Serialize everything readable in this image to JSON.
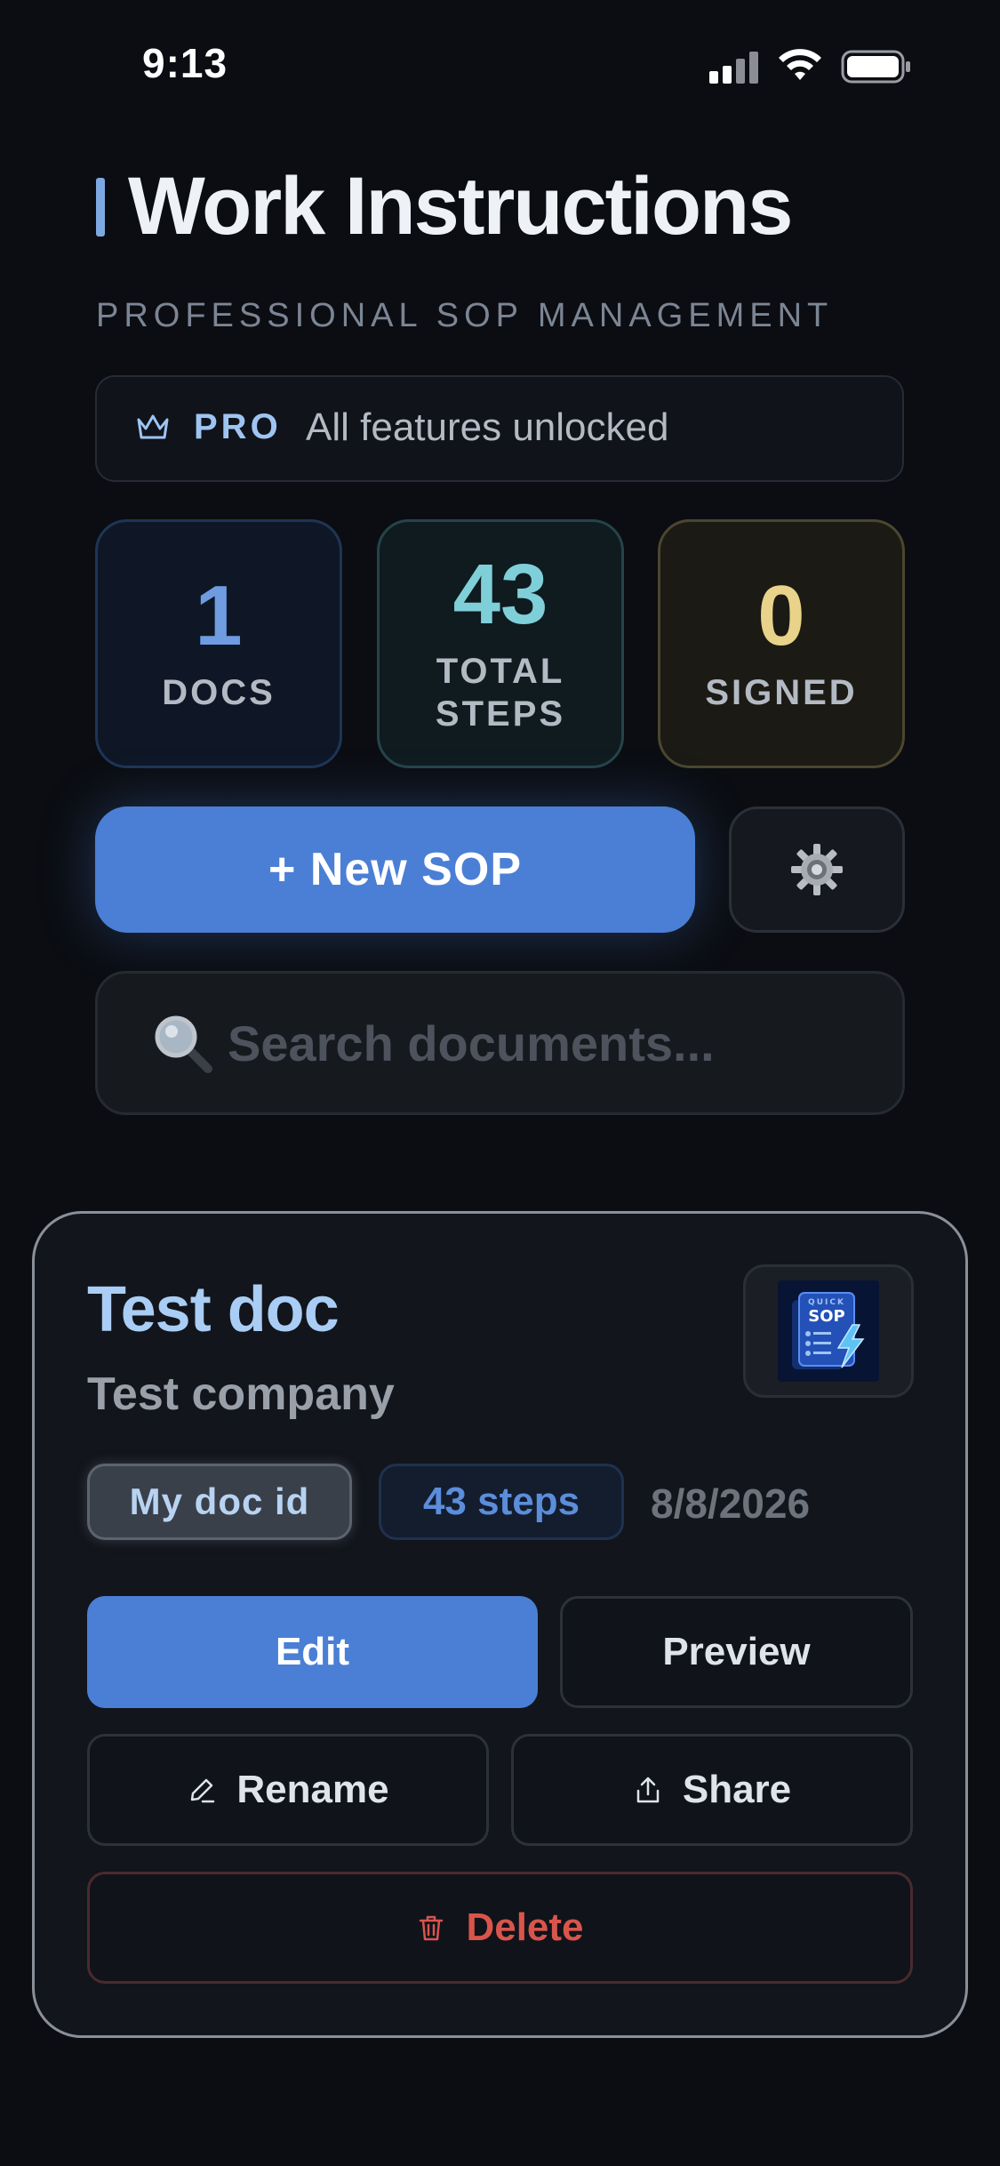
{
  "status_bar": {
    "time": "9:13"
  },
  "header": {
    "title": "Work Instructions",
    "subtitle": "PROFESSIONAL SOP MANAGEMENT"
  },
  "pro_banner": {
    "badge": "PRO",
    "text": "All features unlocked",
    "icon": "crown-icon"
  },
  "stats": [
    {
      "value": "1",
      "label": "DOCS"
    },
    {
      "value": "43",
      "label": "TOTAL STEPS"
    },
    {
      "value": "0",
      "label": "SIGNED"
    }
  ],
  "actions": {
    "new_sop": "+ New SOP",
    "settings_icon": "gear-icon"
  },
  "search": {
    "placeholder": "Search documents..."
  },
  "document": {
    "title": "Test doc",
    "company": "Test company",
    "doc_id": "My doc id",
    "steps": "43 steps",
    "date": "8/8/2026",
    "thumbnail_label": "SOP",
    "thumbnail_sub": "QUICK",
    "buttons": {
      "edit": "Edit",
      "preview": "Preview",
      "rename": "Rename",
      "share": "Share",
      "delete": "Delete"
    }
  },
  "colors": {
    "accent": "#4a7fd5",
    "docs": "#6f9ce0",
    "steps": "#7fcfd9",
    "signed": "#e9d38a",
    "danger": "#d9554c"
  }
}
